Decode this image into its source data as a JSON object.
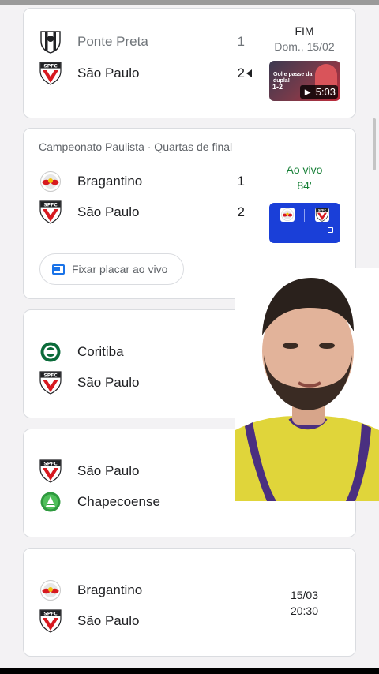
{
  "matches": [
    {
      "title": "",
      "home": {
        "name": "Ponte Preta",
        "score": "1",
        "crest": "ponte-preta-crest"
      },
      "away": {
        "name": "São Paulo",
        "score": "2",
        "crest": "sao-paulo-crest"
      },
      "status": {
        "line1": "FIM",
        "line2": "Dom., 15/02"
      },
      "video": {
        "title": "Gol e passe da dupla!",
        "score": "1-2",
        "duration": "5:03"
      }
    },
    {
      "title": "Campeonato Paulista · Quartas de final",
      "home": {
        "name": "Bragantino",
        "score": "1",
        "crest": "bragantino-crest"
      },
      "away": {
        "name": "São Paulo",
        "score": "2",
        "crest": "sao-paulo-crest"
      },
      "status": {
        "line1": "Ao vivo",
        "line2": "84'"
      },
      "pin_label": "Fixar placar ao vivo"
    },
    {
      "home": {
        "name": "Coritiba",
        "crest": "coritiba-crest"
      },
      "away": {
        "name": "São Paulo",
        "crest": "sao-paulo-crest"
      }
    },
    {
      "home": {
        "name": "São Paulo",
        "crest": "sao-paulo-crest"
      },
      "away": {
        "name": "Chapecoense",
        "crest": "chapecoense-crest"
      }
    },
    {
      "home": {
        "name": "Bragantino",
        "crest": "bragantino-crest"
      },
      "away": {
        "name": "São Paulo",
        "crest": "sao-paulo-crest"
      },
      "status": {
        "line1": "15/03",
        "line2": "20:30"
      }
    }
  ],
  "colors": {
    "live": "#188038",
    "accent": "#1a73e8",
    "sao_paulo_red": "#d71920",
    "video_blue": "#1a3fd8"
  }
}
